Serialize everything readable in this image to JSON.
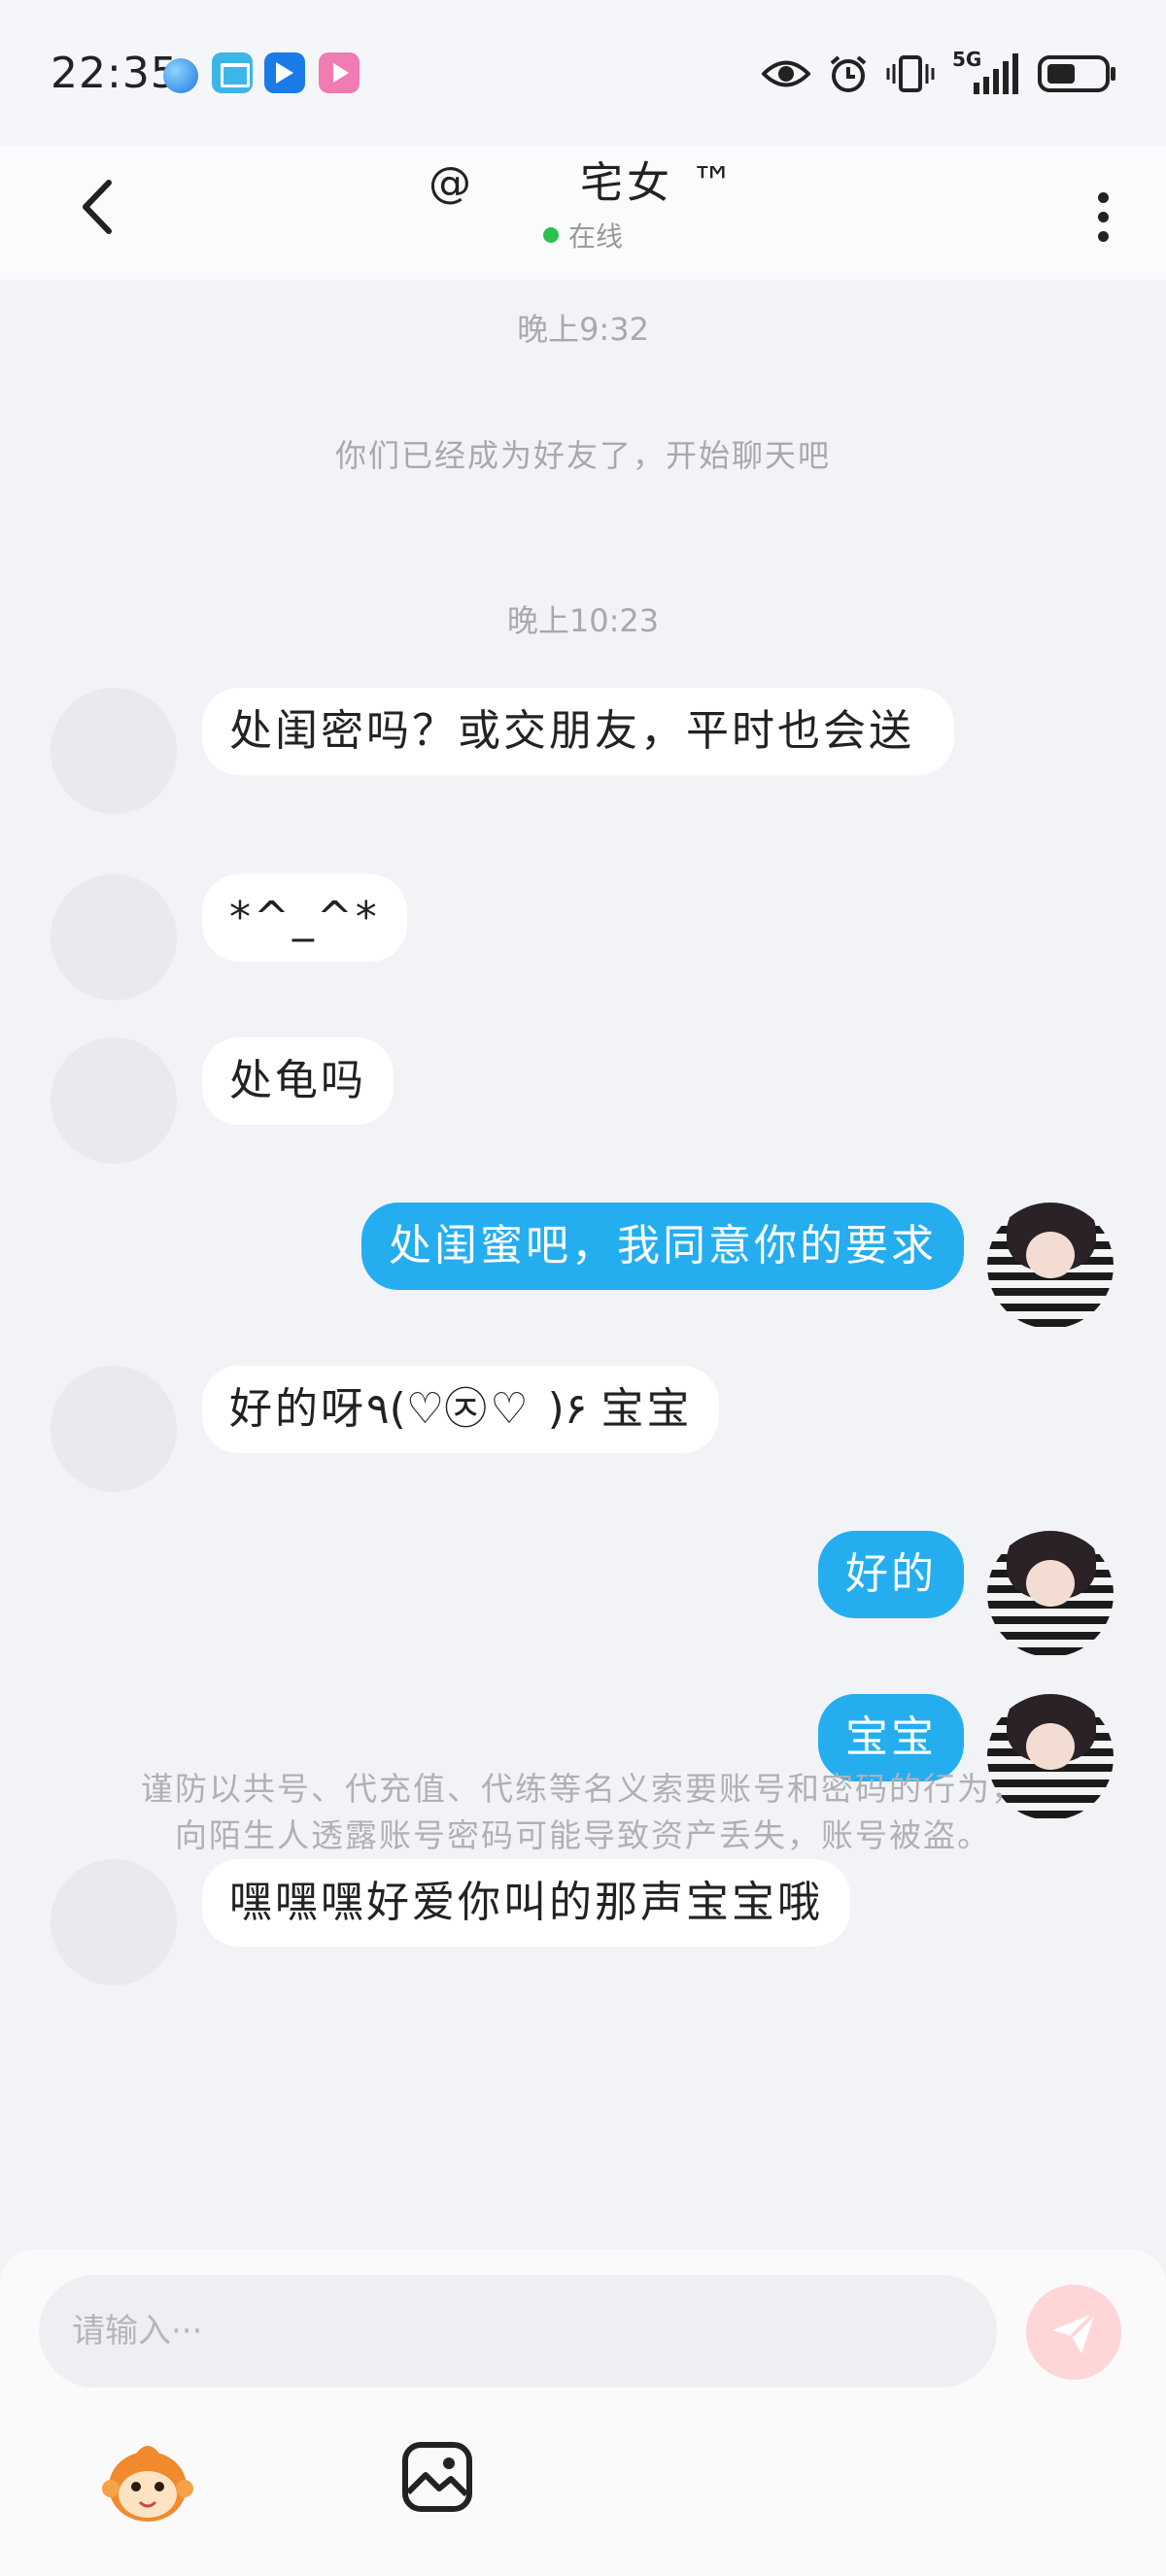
{
  "status_bar": {
    "time": "22:35",
    "network": "5G"
  },
  "header": {
    "contact_name": "@      宅女 ™",
    "status": "在线",
    "status_color": "#2ec04f"
  },
  "chat": {
    "timestamp_1": "晚上9:32",
    "system_message": "你们已经成为好友了，开始聊天吧",
    "timestamp_2": "晚上10:23",
    "messages": [
      {
        "side": "incoming",
        "text": "处闺密吗？或交朋友，平时也会送"
      },
      {
        "side": "incoming",
        "text": "*^_^*"
      },
      {
        "side": "incoming",
        "text": "处龟吗"
      },
      {
        "side": "outgoing",
        "text": "处闺蜜吧，我同意你的要求"
      },
      {
        "side": "incoming",
        "text": "好的呀٩(♡㉨♡ )۶ 宝宝"
      },
      {
        "side": "outgoing",
        "text": "好的"
      },
      {
        "side": "outgoing",
        "text": "宝宝"
      },
      {
        "side": "incoming",
        "text": "嘿嘿嘿好爱你叫的那声宝宝哦"
      }
    ],
    "disclaimer": "谨防以共号、代充值、代练等名义索要账号和密码的行为，向陌生人透露账号密码可能导致资产丢失，账号被盗。"
  },
  "input": {
    "placeholder": "请输入···"
  },
  "colors": {
    "outgoing_bubble": "#24aef0",
    "incoming_bubble": "#ffffff",
    "send_button": "#ffd6d8"
  },
  "icons": [
    "back-arrow-icon",
    "more-vertical-icon",
    "send-icon",
    "mascot-icon",
    "image-icon",
    "eye-icon",
    "alarm-icon",
    "vibrate-icon",
    "signal-icon",
    "battery-icon"
  ]
}
